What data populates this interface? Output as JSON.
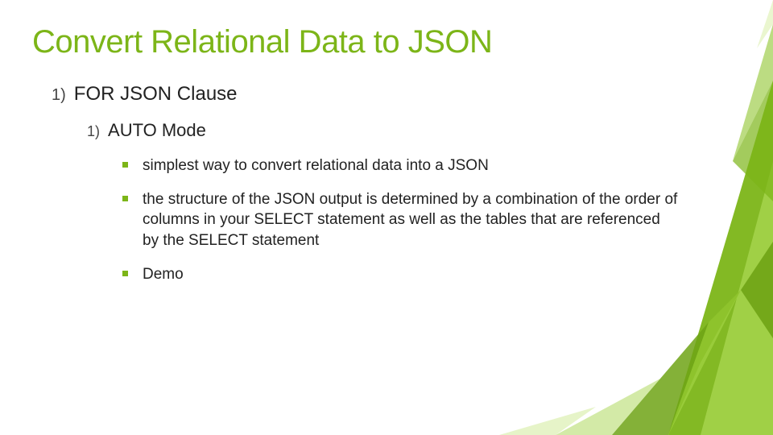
{
  "title": "Convert Relational Data to JSON",
  "outline": {
    "item1": {
      "num": "1)",
      "text": "FOR JSON Clause",
      "sub": {
        "num": "1)",
        "text": "AUTO Mode",
        "bullets": [
          "simplest way to convert relational data into a JSON",
          "the structure of the JSON output is determined by a combination of the order of columns in your SELECT statement as well as the tables that are referenced by the SELECT statement",
          "Demo"
        ]
      }
    }
  },
  "colors": {
    "accent": "#7cb518",
    "accentLight": "#a8d64f",
    "accentDark": "#5a8a0f"
  }
}
